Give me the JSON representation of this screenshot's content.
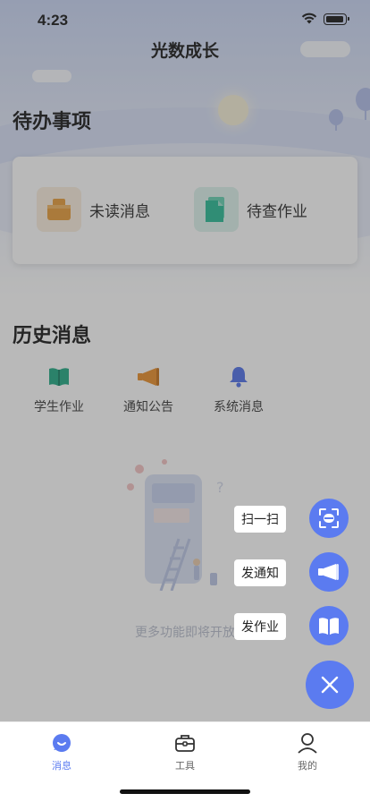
{
  "status_bar": {
    "time": "4:23"
  },
  "header": {
    "title": "光数成长"
  },
  "todo": {
    "title": "待办事项",
    "items": [
      {
        "label": "未读消息",
        "icon": "inbox-icon",
        "color": "#e79a34"
      },
      {
        "label": "待查作业",
        "icon": "document-icon",
        "color": "#23b891"
      }
    ]
  },
  "history": {
    "title": "历史消息",
    "items": [
      {
        "label": "学生作业",
        "icon": "book-icon",
        "color": "#1aa680"
      },
      {
        "label": "通知公告",
        "icon": "megaphone-icon",
        "color": "#e88b24"
      },
      {
        "label": "系统消息",
        "icon": "bell-icon",
        "color": "#4b6de8"
      }
    ]
  },
  "empty_state": {
    "text": "更多功能即将开放"
  },
  "fab_menu": {
    "items": [
      {
        "label": "扫一扫",
        "icon": "scan-icon"
      },
      {
        "label": "发通知",
        "icon": "megaphone-icon"
      },
      {
        "label": "发作业",
        "icon": "book-icon"
      }
    ],
    "close_icon": "close-icon",
    "accent": "#5b7bf0"
  },
  "tab_bar": {
    "items": [
      {
        "label": "消息",
        "icon": "message-icon",
        "active": true
      },
      {
        "label": "工具",
        "icon": "toolbox-icon",
        "active": false
      },
      {
        "label": "我的",
        "icon": "user-icon",
        "active": false
      }
    ]
  }
}
